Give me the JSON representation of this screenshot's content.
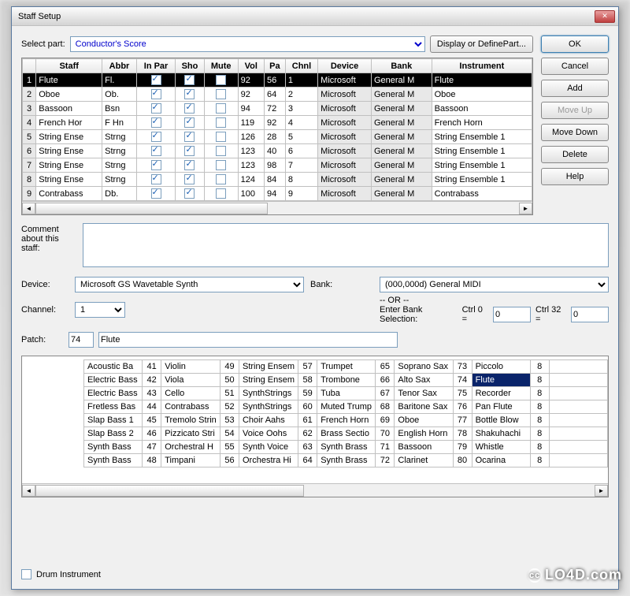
{
  "window": {
    "title": "Staff Setup"
  },
  "selectPart": {
    "label": "Select part:",
    "value": "Conductor's Score"
  },
  "displayButton": "Display or DefinePart...",
  "sidebar": {
    "ok": "OK",
    "cancel": "Cancel",
    "add": "Add",
    "moveUp": "Move Up",
    "moveDown": "Move Down",
    "delete": "Delete",
    "help": "Help"
  },
  "staffTable": {
    "headers": [
      "",
      "Staff",
      "Abbr",
      "In Par",
      "Sho",
      "Mute",
      "Vol",
      "Pa",
      "Chnl",
      "Device",
      "Bank",
      "Instrument"
    ],
    "rows": [
      {
        "n": 1,
        "staff": "Flute",
        "abbr": "Fl.",
        "inpar": true,
        "sho": true,
        "mute": false,
        "vol": 92,
        "pa": 56,
        "chnl": 1,
        "device": "Microsoft ",
        "bank": "General M",
        "inst": "Flute",
        "sel": true
      },
      {
        "n": 2,
        "staff": "Oboe",
        "abbr": "Ob.",
        "inpar": true,
        "sho": true,
        "mute": false,
        "vol": 92,
        "pa": 64,
        "chnl": 2,
        "device": "Microsoft ",
        "bank": "General M",
        "inst": "Oboe"
      },
      {
        "n": 3,
        "staff": "Bassoon",
        "abbr": "Bsn",
        "inpar": true,
        "sho": true,
        "mute": false,
        "vol": 94,
        "pa": 72,
        "chnl": 3,
        "device": "Microsoft ",
        "bank": "General M",
        "inst": "Bassoon"
      },
      {
        "n": 4,
        "staff": "French Hor",
        "abbr": "F Hn",
        "inpar": true,
        "sho": true,
        "mute": false,
        "vol": 119,
        "pa": 92,
        "chnl": 4,
        "device": "Microsoft ",
        "bank": "General M",
        "inst": "French Horn"
      },
      {
        "n": 5,
        "staff": "String Ense",
        "abbr": "Strng",
        "inpar": true,
        "sho": true,
        "mute": false,
        "vol": 126,
        "pa": 28,
        "chnl": 5,
        "device": "Microsoft ",
        "bank": "General M",
        "inst": "String Ensemble 1"
      },
      {
        "n": 6,
        "staff": "String Ense",
        "abbr": "Strng",
        "inpar": true,
        "sho": true,
        "mute": false,
        "vol": 123,
        "pa": 40,
        "chnl": 6,
        "device": "Microsoft ",
        "bank": "General M",
        "inst": "String Ensemble 1"
      },
      {
        "n": 7,
        "staff": "String Ense",
        "abbr": "Strng",
        "inpar": true,
        "sho": true,
        "mute": false,
        "vol": 123,
        "pa": 98,
        "chnl": 7,
        "device": "Microsoft ",
        "bank": "General M",
        "inst": "String Ensemble 1"
      },
      {
        "n": 8,
        "staff": "String Ense",
        "abbr": "Strng",
        "inpar": true,
        "sho": true,
        "mute": false,
        "vol": 124,
        "pa": 84,
        "chnl": 8,
        "device": "Microsoft ",
        "bank": "General M",
        "inst": "String Ensemble 1"
      },
      {
        "n": 9,
        "staff": "Contrabass",
        "abbr": "Db.",
        "inpar": true,
        "sho": true,
        "mute": false,
        "vol": 100,
        "pa": 94,
        "chnl": 9,
        "device": "Microsoft ",
        "bank": "General M",
        "inst": "Contrabass"
      }
    ]
  },
  "comment": {
    "label": "Comment about this staff:",
    "value": ""
  },
  "device": {
    "label": "Device:",
    "value": "Microsoft GS Wavetable Synth"
  },
  "bank": {
    "label": "Bank:",
    "value": "(000,000d) General MIDI"
  },
  "channel": {
    "label": "Channel:",
    "value": "1"
  },
  "orText": "-- OR --",
  "bankSel": {
    "label": "Enter Bank Selection:",
    "ctrl0": "Ctrl 0 =",
    "ctrl0val": "0",
    "ctrl32": "Ctrl 32 =",
    "ctrl32val": "0"
  },
  "patch": {
    "label": "Patch:",
    "num": "74",
    "name": "Flute"
  },
  "patchList": {
    "columns": [
      [
        [
          "",
          "Acoustic Ba"
        ],
        [
          "",
          "Electric Bass"
        ],
        [
          "",
          "Electric Bass"
        ],
        [
          "",
          "Fretless Bas"
        ],
        [
          "",
          "Slap Bass 1"
        ],
        [
          "",
          "Slap Bass 2"
        ],
        [
          "",
          "Synth Bass"
        ],
        [
          "",
          "Synth Bass"
        ]
      ],
      [
        [
          41,
          "Violin"
        ],
        [
          42,
          "Viola"
        ],
        [
          43,
          "Cello"
        ],
        [
          44,
          "Contrabass"
        ],
        [
          45,
          "Tremolo Strin"
        ],
        [
          46,
          "Pizzicato Stri"
        ],
        [
          47,
          "Orchestral H"
        ],
        [
          48,
          "Timpani"
        ]
      ],
      [
        [
          49,
          "String Ensem"
        ],
        [
          50,
          "String Ensem"
        ],
        [
          51,
          "SynthStrings"
        ],
        [
          52,
          "SynthStrings"
        ],
        [
          53,
          "Choir Aahs"
        ],
        [
          54,
          "Voice Oohs"
        ],
        [
          55,
          "Synth Voice"
        ],
        [
          56,
          "Orchestra Hi"
        ]
      ],
      [
        [
          57,
          "Trumpet"
        ],
        [
          58,
          "Trombone"
        ],
        [
          59,
          "Tuba"
        ],
        [
          60,
          "Muted Trump"
        ],
        [
          61,
          "French Horn"
        ],
        [
          62,
          "Brass Sectio"
        ],
        [
          63,
          "Synth Brass"
        ],
        [
          64,
          "Synth Brass"
        ]
      ],
      [
        [
          65,
          "Soprano Sax"
        ],
        [
          66,
          "Alto Sax"
        ],
        [
          67,
          "Tenor Sax"
        ],
        [
          68,
          "Baritone Sax"
        ],
        [
          69,
          "Oboe"
        ],
        [
          70,
          "English Horn"
        ],
        [
          71,
          "Bassoon"
        ],
        [
          72,
          "Clarinet"
        ]
      ],
      [
        [
          73,
          "Piccolo"
        ],
        [
          74,
          "Flute"
        ],
        [
          75,
          "Recorder"
        ],
        [
          76,
          "Pan Flute"
        ],
        [
          77,
          "Bottle Blow"
        ],
        [
          78,
          "Shakuhachi"
        ],
        [
          79,
          "Whistle"
        ],
        [
          80,
          "Ocarina"
        ]
      ],
      [
        [
          "8",
          ""
        ],
        [
          "8",
          ""
        ],
        [
          "8",
          ""
        ],
        [
          "8",
          ""
        ],
        [
          "8",
          ""
        ],
        [
          "8",
          ""
        ],
        [
          "8",
          ""
        ],
        [
          "8",
          ""
        ]
      ]
    ],
    "selectedNum": 74
  },
  "drum": {
    "label": "Drum Instrument",
    "checked": false
  },
  "watermark": "LO4D.com"
}
